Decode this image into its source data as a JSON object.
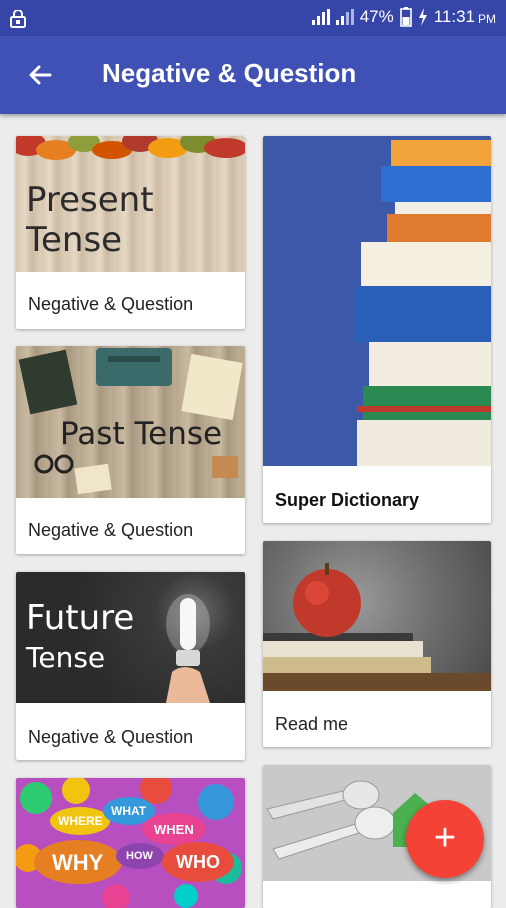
{
  "status_bar": {
    "battery": "47%",
    "time": "11:31",
    "ampm": "PM",
    "icons": [
      "lock-icon",
      "signal-icon",
      "signal-icon",
      "battery-icon",
      "charging-icon"
    ]
  },
  "app_bar": {
    "title": "Negative & Question",
    "back_icon": "arrow-back-icon"
  },
  "cards": [
    {
      "image_text": [
        "Present",
        "Tense"
      ],
      "caption": "Negative & Question"
    },
    {
      "image_text": [
        "Past Tense"
      ],
      "caption": "Negative & Question"
    },
    {
      "image_text": [
        "Future",
        "Tense"
      ],
      "caption": "Negative & Question"
    },
    {
      "image_text": [
        "WHERE",
        "WHAT",
        "WHEN",
        "WHY",
        "HOW",
        "WHO"
      ],
      "caption": ""
    },
    {
      "image_text": [],
      "caption": "Super Dictionary"
    },
    {
      "image_text": [],
      "caption": "Read me"
    },
    {
      "image_text": [],
      "caption": ""
    }
  ],
  "fab": {
    "label": "+",
    "icon": "add-icon",
    "color": "#f44336"
  },
  "colors": {
    "primary": "#3f51b5",
    "primary_dark": "#3546a8",
    "accent": "#f44336"
  }
}
